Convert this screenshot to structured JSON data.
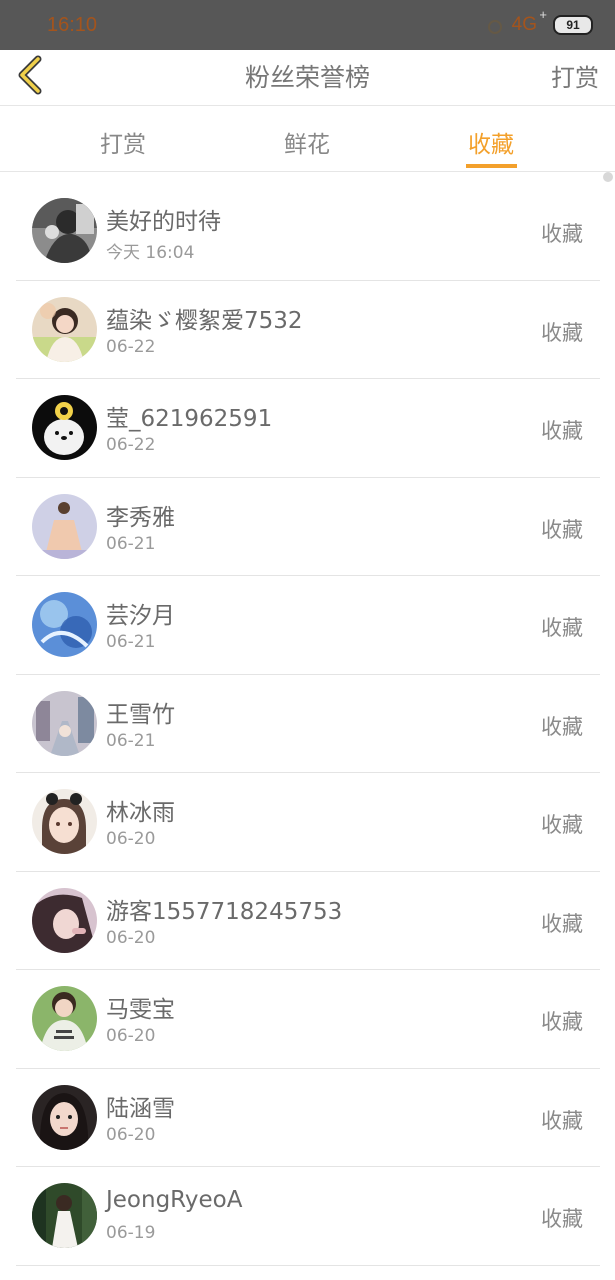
{
  "status_bar": {
    "time": "16:10",
    "network": "4G",
    "network_plus": "+",
    "battery": "91"
  },
  "nav": {
    "title": "粉丝荣誉榜",
    "right_action": "打赏"
  },
  "tabs": [
    {
      "label": "打赏",
      "active": false
    },
    {
      "label": "鲜花",
      "active": false
    },
    {
      "label": "收藏",
      "active": true
    }
  ],
  "colors": {
    "accent": "#f3a02b",
    "status_bar_bg": "#575757"
  },
  "fans": [
    {
      "name": "美好的时待",
      "time": "今天 16:04",
      "action": "收藏",
      "avatar": "avatar-photo-grayscale"
    },
    {
      "name": "蕴染ゞ樱絮爱7532",
      "time": "06-22",
      "action": "收藏",
      "avatar": "avatar-photo-girl-pink"
    },
    {
      "name": "莹_621962591",
      "time": "06-22",
      "action": "收藏",
      "avatar": "avatar-cartoon-chick"
    },
    {
      "name": "李秀雅",
      "time": "06-21",
      "action": "收藏",
      "avatar": "avatar-photo-dress"
    },
    {
      "name": "芸汐月",
      "time": "06-21",
      "action": "收藏",
      "avatar": "avatar-illustration-blue"
    },
    {
      "name": "王雪竹",
      "time": "06-21",
      "action": "收藏",
      "avatar": "avatar-illustration-street"
    },
    {
      "name": "林冰雨",
      "time": "06-20",
      "action": "收藏",
      "avatar": "avatar-illustration-girl"
    },
    {
      "name": "游客1557718245753",
      "time": "06-20",
      "action": "收藏",
      "avatar": "avatar-photo-girl-purple"
    },
    {
      "name": "马雯宝",
      "time": "06-20",
      "action": "收藏",
      "avatar": "avatar-photo-girl-green"
    },
    {
      "name": "陆涵雪",
      "time": "06-20",
      "action": "收藏",
      "avatar": "avatar-photo-woman-dark"
    },
    {
      "name": "JeongRyeoA",
      "time": "06-19",
      "action": "收藏",
      "avatar": "avatar-photo-girl-forest"
    }
  ]
}
